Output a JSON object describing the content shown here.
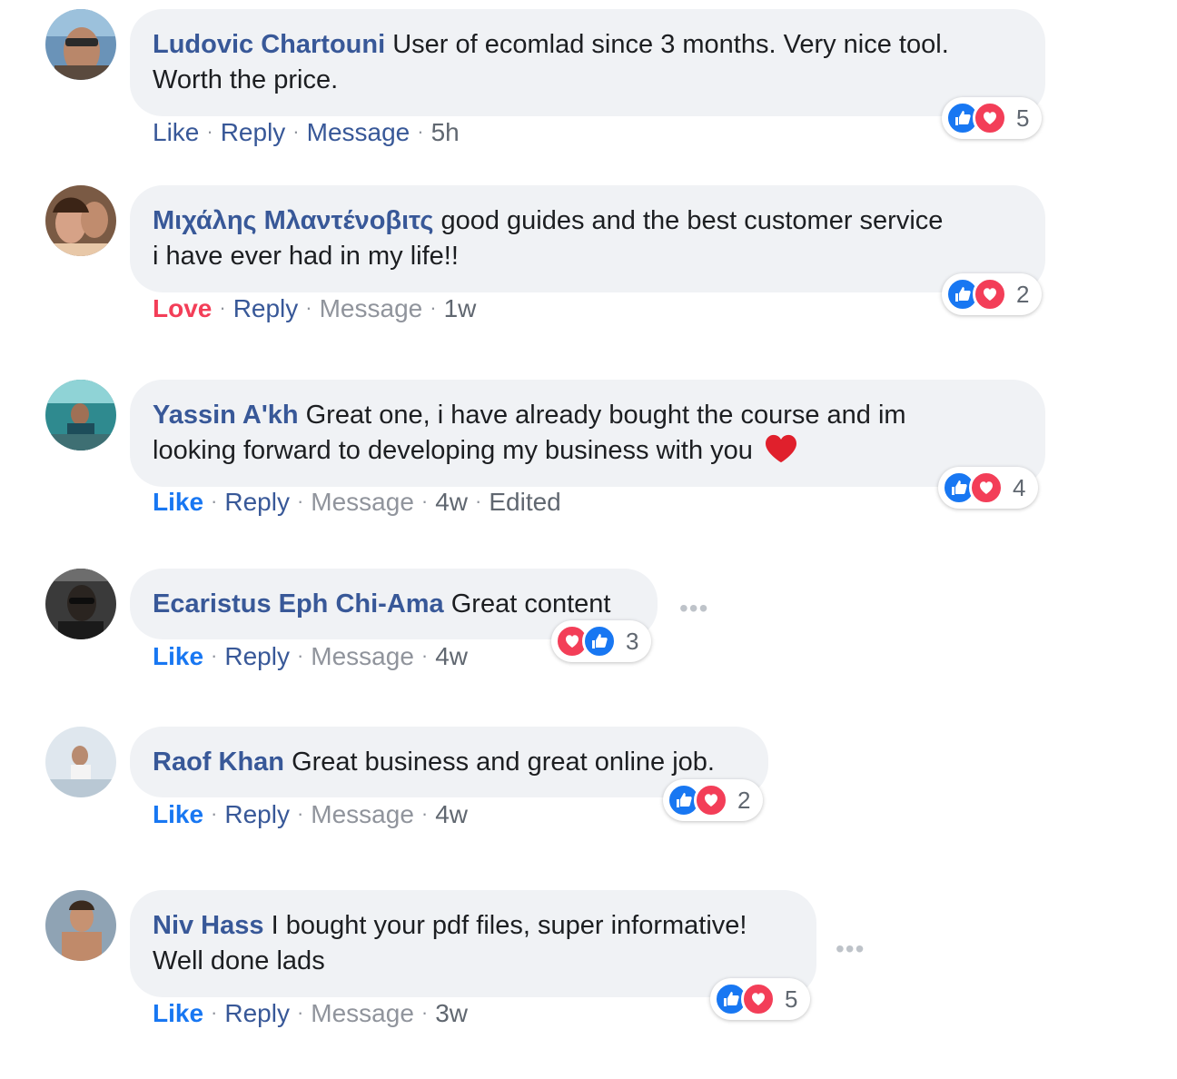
{
  "comments": [
    {
      "author": "Ludovic Chartouni",
      "text": "User of ecomlad since 3 months. Very nice tool.",
      "text2": "Worth the price.",
      "actions": {
        "like": "Like",
        "reply": "Reply",
        "message": "Message",
        "time": "5h",
        "sep": "·"
      },
      "reaction_count": "5",
      "reaction_icons": [
        "like",
        "love"
      ]
    },
    {
      "author": "Μιχάλης Μλαντένοβιτς",
      "text": "good guides and the best customer service",
      "text2": "i have ever had in my life!!",
      "actions": {
        "like": "Love",
        "reply": "Reply",
        "message": "Message",
        "time": "1w",
        "sep": "·"
      },
      "reaction_count": "2",
      "reaction_icons": [
        "like",
        "love"
      ]
    },
    {
      "author": "Yassin A'kh",
      "text": "Great one, i have already bought the course and im",
      "text2": "looking forward to developing my business with you",
      "actions": {
        "like": "Like",
        "reply": "Reply",
        "message": "Message",
        "time": "4w",
        "edited": "Edited",
        "sep": "·"
      },
      "reaction_count": "4",
      "reaction_icons": [
        "like",
        "love"
      ]
    },
    {
      "author": "Ecaristus Eph Chi-Ama",
      "text": "Great content",
      "actions": {
        "like": "Like",
        "reply": "Reply",
        "message": "Message",
        "time": "4w",
        "sep": "·"
      },
      "reaction_count": "3",
      "reaction_icons": [
        "love",
        "like"
      ],
      "more": "•••"
    },
    {
      "author": "Raof Khan",
      "text": "Great business and great online job.",
      "actions": {
        "like": "Like",
        "reply": "Reply",
        "message": "Message",
        "time": "4w",
        "sep": "·"
      },
      "reaction_count": "2",
      "reaction_icons": [
        "like",
        "love"
      ]
    },
    {
      "author": "Niv Hass",
      "text": "I bought your pdf files, super informative!",
      "text2": "Well done lads",
      "actions": {
        "like": "Like",
        "reply": "Reply",
        "message": "Message",
        "time": "3w",
        "sep": "·"
      },
      "reaction_count": "5",
      "reaction_icons": [
        "like",
        "love"
      ],
      "more": "•••"
    }
  ],
  "colors": {
    "author": "#385898",
    "like_active": "#1877f2",
    "love": "#f33e58",
    "bubble": "#f0f2f5",
    "muted": "#90949c"
  }
}
